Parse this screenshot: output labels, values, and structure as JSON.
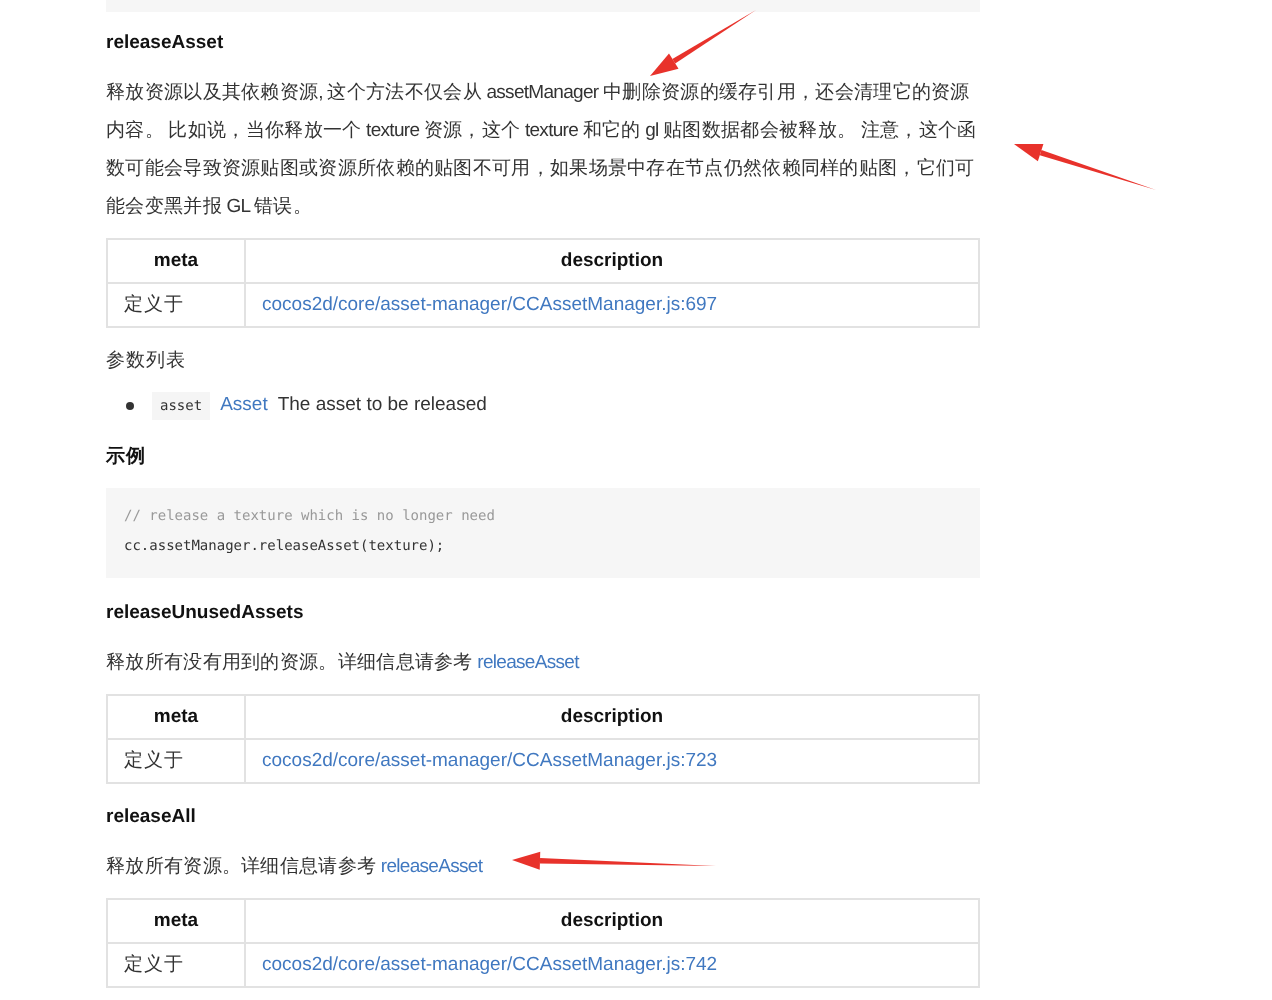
{
  "blocks": [
    {
      "kind": "code_end"
    },
    {
      "kind": "heading",
      "text": "releaseAsset"
    },
    {
      "kind": "paragraph",
      "text": "释放资源以及其依赖资源, 这个方法不仅会从 assetManager 中删除资源的缓存引用，还会清理它的资源内容。 比如说，当你释放一个 texture 资源，这个 texture 和它的 gl 贴图数据都会被释放。 注意，这个函数可能会导致资源贴图或资源所依赖的贴图不可用，如果场景中存在节点仍然依赖同样的贴图，它们可能会变黑并报 GL 错误。"
    },
    {
      "kind": "table",
      "columns": [
        "meta",
        "description"
      ],
      "rows": [
        {
          "label": "定义于",
          "link": "cocos2d/core/asset-manager/CCAssetManager.js:697"
        }
      ]
    },
    {
      "kind": "subtitle",
      "text": "参数列表"
    },
    {
      "kind": "param",
      "name": "asset",
      "type": "Asset",
      "text": "The asset to be released"
    },
    {
      "kind": "heading",
      "text": "示例"
    },
    {
      "kind": "code",
      "lines": [
        {
          "kind": "comment",
          "text": "// release a texture which is no longer need"
        },
        {
          "kind": "code",
          "text": "cc.assetManager.releaseAsset(texture);"
        }
      ]
    },
    {
      "kind": "heading",
      "text": "releaseUnusedAssets"
    },
    {
      "kind": "paragraph",
      "text": "释放所有没有用到的资源。详细信息请参考 ",
      "link": "releaseAsset"
    },
    {
      "kind": "table",
      "columns": [
        "meta",
        "description"
      ],
      "rows": [
        {
          "label": "定义于",
          "link": "cocos2d/core/asset-manager/CCAssetManager.js:723"
        }
      ]
    },
    {
      "kind": "heading",
      "text": "releaseAll"
    },
    {
      "kind": "paragraph",
      "text": "释放所有资源。详细信息请参考 ",
      "link": "releaseAsset"
    },
    {
      "kind": "table",
      "columns": [
        "meta",
        "description"
      ],
      "rows": [
        {
          "label": "定义于",
          "link": "cocos2d/core/asset-manager/CCAssetManager.js:742"
        }
      ]
    }
  ],
  "annotations": [
    {
      "kind": "arrow"
    },
    {
      "kind": "arrow"
    },
    {
      "kind": "arrow"
    }
  ]
}
